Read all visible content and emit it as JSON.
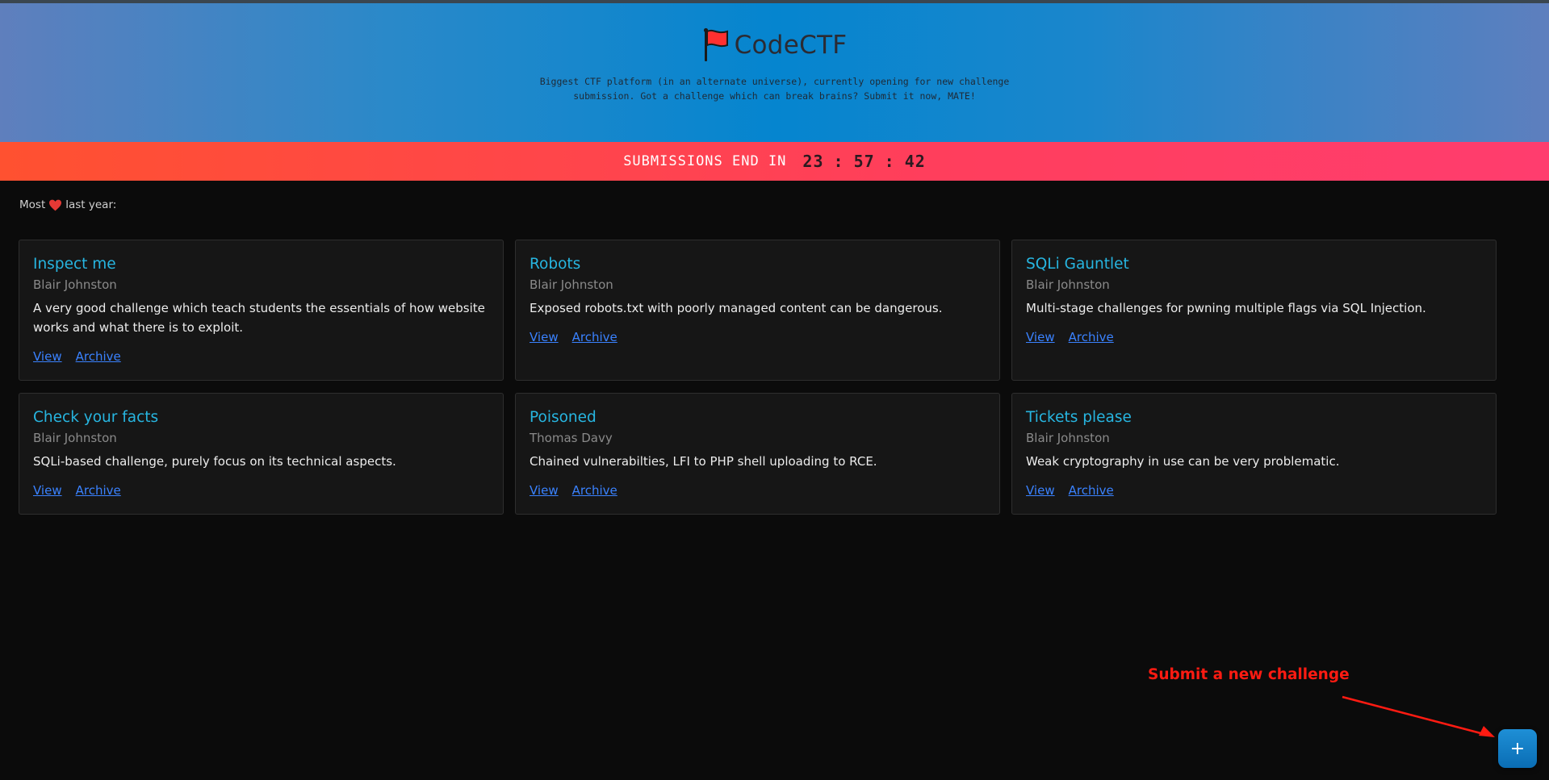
{
  "header": {
    "brand": "CodeCTF",
    "tagline": "Biggest CTF platform (in an alternate universe), currently opening for new challenge submission. Got a challenge which can break brains? Submit it now, MATE!"
  },
  "banner": {
    "label": "SUBMISSIONS END IN",
    "hours": "23",
    "minutes": "57",
    "seconds": "42",
    "separator": ":"
  },
  "section": {
    "prefix": "Most",
    "suffix": "last year:"
  },
  "challenges": [
    {
      "title": "Inspect me",
      "author": "Blair Johnston",
      "description": "A very good challenge which teach students the essentials of how website works and what there is to exploit.",
      "view": "View",
      "archive": "Archive"
    },
    {
      "title": "Robots",
      "author": "Blair Johnston",
      "description": "Exposed robots.txt with poorly managed content can be dangerous.",
      "view": "View",
      "archive": "Archive"
    },
    {
      "title": "SQLi Gauntlet",
      "author": "Blair Johnston",
      "description": "Multi-stage challenges for pwning multiple flags via SQL Injection.",
      "view": "View",
      "archive": "Archive"
    },
    {
      "title": "Check your facts",
      "author": "Blair Johnston",
      "description": "SQLi-based challenge, purely focus on its technical aspects.",
      "view": "View",
      "archive": "Archive"
    },
    {
      "title": "Poisoned",
      "author": "Thomas Davy",
      "description": "Chained vulnerabilties, LFI to PHP shell uploading to RCE.",
      "view": "View",
      "archive": "Archive"
    },
    {
      "title": "Tickets please",
      "author": "Blair Johnston",
      "description": "Weak cryptography in use can be very problematic.",
      "view": "View",
      "archive": "Archive"
    }
  ],
  "annotation": {
    "text": "Submit a new challenge"
  },
  "fab": {
    "label": "+"
  },
  "colors": {
    "accent": "#27b5e0",
    "link": "#3a82ff",
    "banner": "#ff4347",
    "annotation": "#ff1b12"
  },
  "icons": {
    "brand": "flag-icon",
    "section": "heart-icon"
  }
}
